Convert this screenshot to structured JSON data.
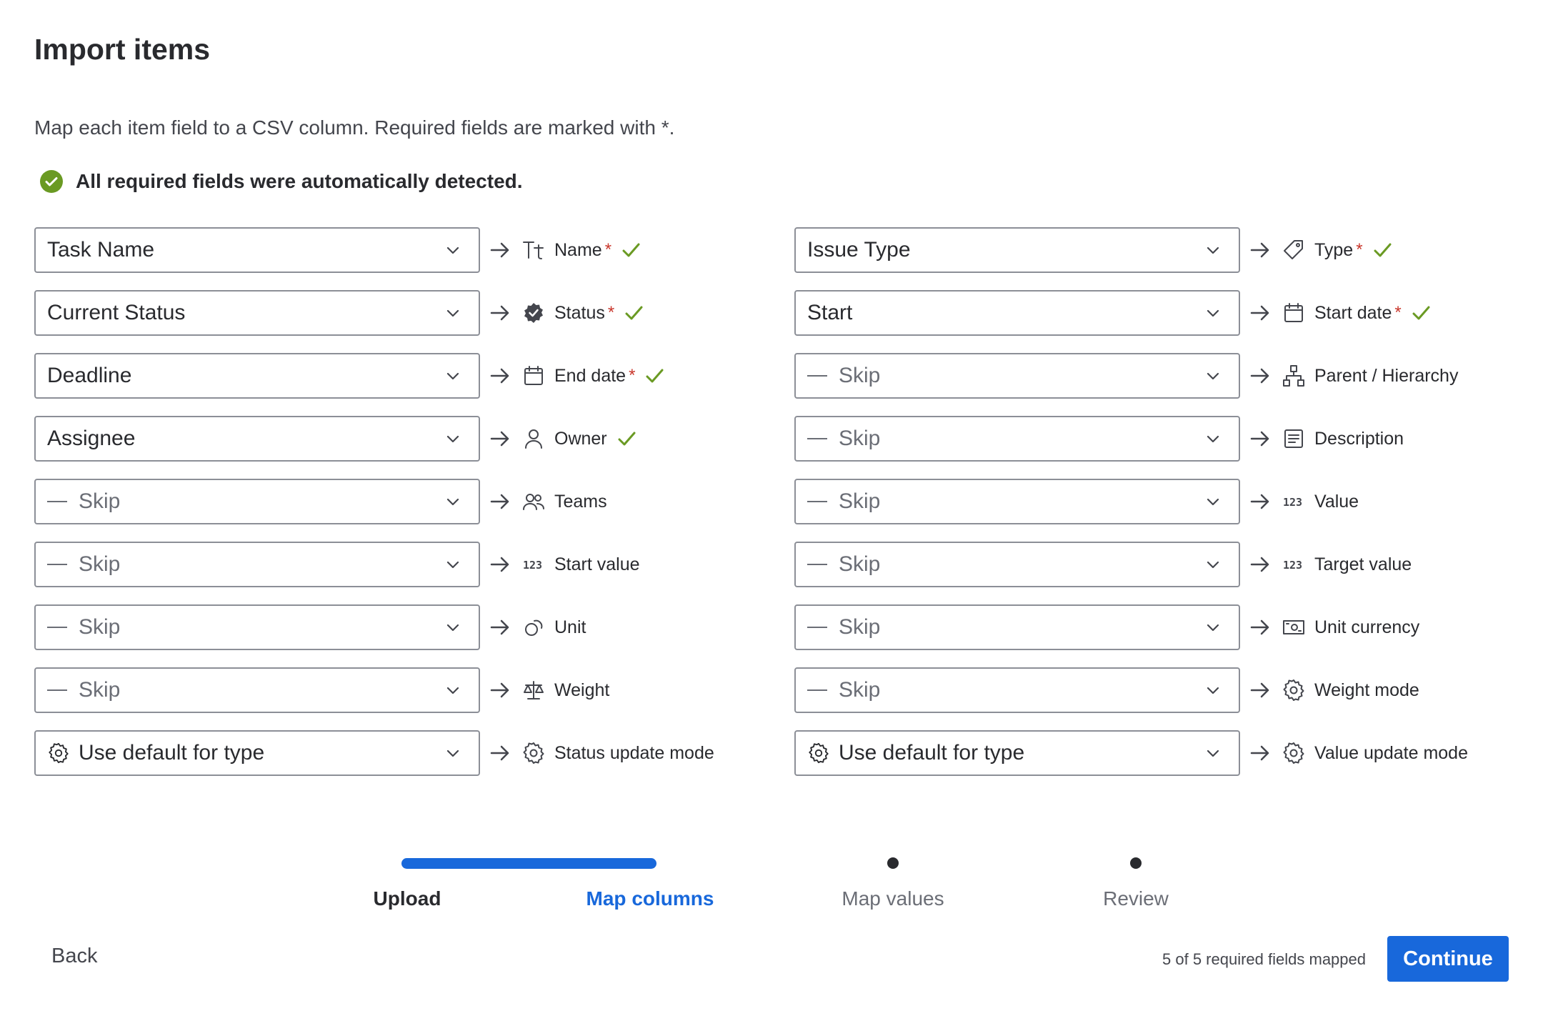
{
  "dialog": {
    "title": "Import items",
    "description": "Map each item field to a CSV column. Required fields are marked with *.",
    "detected_message": "All required fields were automatically detected."
  },
  "left_mappings": [
    {
      "value": "Task Name",
      "skip": false,
      "field": "Name",
      "icon": "text-format-icon",
      "required": true,
      "checked": true
    },
    {
      "value": "Current Status",
      "skip": false,
      "field": "Status",
      "icon": "status-badge-icon",
      "required": true,
      "checked": true
    },
    {
      "value": "Deadline",
      "skip": false,
      "field": "End date",
      "icon": "calendar-icon",
      "required": true,
      "checked": true
    },
    {
      "value": "Assignee",
      "skip": false,
      "field": "Owner",
      "icon": "person-icon",
      "required": false,
      "checked": true
    },
    {
      "value": "Skip",
      "skip": true,
      "field": "Teams",
      "icon": "people-icon",
      "required": false,
      "checked": false
    },
    {
      "value": "Skip",
      "skip": true,
      "field": "Start value",
      "icon": "number-icon",
      "required": false,
      "checked": false
    },
    {
      "value": "Skip",
      "skip": true,
      "field": "Unit",
      "icon": "shapes-icon",
      "required": false,
      "checked": false
    },
    {
      "value": "Skip",
      "skip": true,
      "field": "Weight",
      "icon": "scale-icon",
      "required": false,
      "checked": false
    },
    {
      "value": "Use default for type",
      "skip": false,
      "gear": true,
      "field": "Status update mode",
      "icon": "gear-icon",
      "required": false,
      "checked": false
    }
  ],
  "right_mappings": [
    {
      "value": "Issue Type",
      "skip": false,
      "field": "Type",
      "icon": "tag-icon",
      "required": true,
      "checked": true
    },
    {
      "value": "Start",
      "skip": false,
      "field": "Start date",
      "icon": "calendar-icon",
      "required": true,
      "checked": true
    },
    {
      "value": "Skip",
      "skip": true,
      "field": "Parent / Hierarchy",
      "icon": "hierarchy-icon",
      "required": false,
      "checked": false
    },
    {
      "value": "Skip",
      "skip": true,
      "field": "Description",
      "icon": "document-icon",
      "required": false,
      "checked": false
    },
    {
      "value": "Skip",
      "skip": true,
      "field": "Value",
      "icon": "number-icon",
      "required": false,
      "checked": false
    },
    {
      "value": "Skip",
      "skip": true,
      "field": "Target value",
      "icon": "number-icon",
      "required": false,
      "checked": false
    },
    {
      "value": "Skip",
      "skip": true,
      "field": "Unit currency",
      "icon": "currency-icon",
      "required": false,
      "checked": false
    },
    {
      "value": "Skip",
      "skip": true,
      "field": "Weight mode",
      "icon": "gear-icon",
      "required": false,
      "checked": false
    },
    {
      "value": "Use default for type",
      "skip": false,
      "gear": true,
      "field": "Value update mode",
      "icon": "gear-icon",
      "required": false,
      "checked": false
    }
  ],
  "required_marker": "*",
  "steps": [
    {
      "label": "Upload",
      "state": "done"
    },
    {
      "label": "Map columns",
      "state": "current"
    },
    {
      "label": "Map values",
      "state": "future"
    },
    {
      "label": "Review",
      "state": "future"
    }
  ],
  "footer": {
    "back_label": "Back",
    "mapped_status": "5 of 5 required fields mapped",
    "continue_label": "Continue"
  },
  "colors": {
    "primary": "#1868db",
    "success": "#6a9a23",
    "required": "#c9372c",
    "text": "#292a2e"
  }
}
